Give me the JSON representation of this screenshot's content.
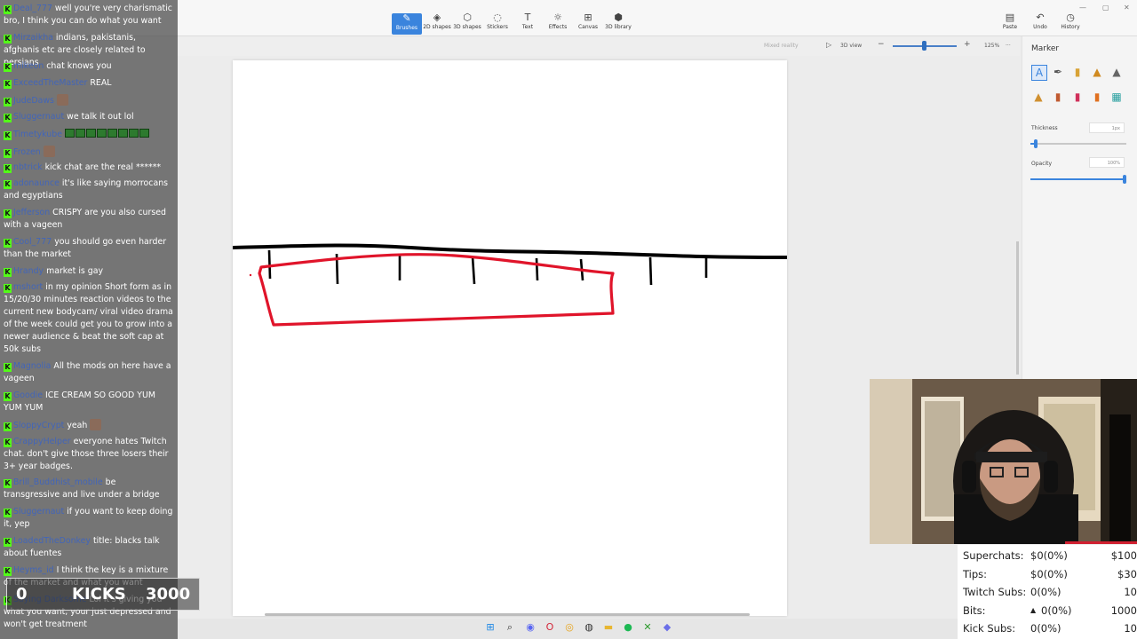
{
  "ribbon": {
    "tools": [
      {
        "label": "Brushes",
        "icon": "brush-icon",
        "glyph": "✎"
      },
      {
        "label": "2D shapes",
        "icon": "shapes-2d-icon",
        "glyph": "◈"
      },
      {
        "label": "3D shapes",
        "icon": "shapes-3d-icon",
        "glyph": "⬡"
      },
      {
        "label": "Stickers",
        "icon": "sticker-icon",
        "glyph": "◌"
      },
      {
        "label": "Text",
        "icon": "text-icon",
        "glyph": "T"
      },
      {
        "label": "Effects",
        "icon": "effects-icon",
        "glyph": "☼"
      },
      {
        "label": "Canvas",
        "icon": "canvas-icon",
        "glyph": "⊞"
      },
      {
        "label": "3D library",
        "icon": "library-3d-icon",
        "glyph": "⬢"
      }
    ],
    "right": [
      {
        "label": "Paste",
        "icon": "paste-icon",
        "glyph": "▤"
      },
      {
        "label": "Undo",
        "icon": "undo-icon",
        "glyph": "↶"
      },
      {
        "label": "History",
        "icon": "history-icon",
        "glyph": "◷"
      }
    ]
  },
  "subbar": {
    "mixed_reality": "Mixed reality",
    "view_3d": "3D view",
    "zoom": "125%",
    "more": "···"
  },
  "panel": {
    "title": "Marker",
    "thickness_label": "Thickness",
    "thickness_value": "1px",
    "thickness_level": 0.04,
    "opacity_label": "Opacity",
    "opacity_value": "100%",
    "opacity_level": 1.0,
    "brushes": [
      {
        "icon": "marker-icon",
        "glyph": "A",
        "color": "#3a84dd"
      },
      {
        "icon": "calligraphy-pen-icon",
        "glyph": "✒",
        "color": "#555"
      },
      {
        "icon": "oil-brush-icon",
        "glyph": "▮",
        "color": "#d8a235"
      },
      {
        "icon": "watercolor-icon",
        "glyph": "▲",
        "color": "#d08a20"
      },
      {
        "icon": "pencil-icon",
        "glyph": "▲",
        "color": "#666"
      },
      {
        "icon": "eraser-icon",
        "glyph": "▲",
        "color": "#d09030"
      },
      {
        "icon": "crayon-icon",
        "glyph": "▮",
        "color": "#c05a30"
      },
      {
        "icon": "pixel-pen-icon",
        "glyph": "▮",
        "color": "#d0305a"
      },
      {
        "icon": "spray-can-icon",
        "glyph": "▮",
        "color": "#e07020"
      },
      {
        "icon": "fill-icon",
        "glyph": "▦",
        "color": "#2aa0a0"
      }
    ]
  },
  "chat": {
    "messages": [
      {
        "user": "Deal_777",
        "text": "well you're very charismatic bro, I think you can do what you want"
      },
      {
        "user": "Mirzaikha",
        "text": "indians, pakistanis, afghanis etc are closely related to persians"
      },
      {
        "user": "mikeon",
        "text": "chat knows you"
      },
      {
        "user": "ExceedTheMaster",
        "text": "REAL"
      },
      {
        "user": "JudeDaws",
        "text": "",
        "emote": true
      },
      {
        "user": "Sluggernaut",
        "text": "we talk it out lol"
      },
      {
        "user": "Timetykube",
        "text": "",
        "emote_row": 8
      },
      {
        "user": "Frozen",
        "text": "",
        "emote": true
      },
      {
        "user": "nbtrick",
        "text": "kick chat are the real ******"
      },
      {
        "user": "adonaunce",
        "text": "it's like saying morrocans and egyptians"
      },
      {
        "user": "Jefferson",
        "text": "CRISPY are you also cursed with a vageen"
      },
      {
        "user": "Cool_777",
        "text": "you should go even harder than the market"
      },
      {
        "user": "Hrandy",
        "text": "market is gay"
      },
      {
        "user": "mshort",
        "text": "in my opinion Short form as in 15/20/30 minutes reaction videos to the current new bodycam/ viral video drama of the week could get you to grow into a newer audience & beat the soft cap at 50k subs"
      },
      {
        "user": "Magnolia",
        "text": "All the mods on here have a vageen"
      },
      {
        "user": "Goodie",
        "text": "ICE CREAM SO GOOD YUM YUM YUM"
      },
      {
        "user": "SloppyCrypt",
        "text": "yeah",
        "emote": true
      },
      {
        "user": "CrappyHelper",
        "text": "everyone hates Twitch chat. don't give those three losers their 3+ year badges."
      },
      {
        "user": "Brill_Buddhist_mobile",
        "text": "be transgressive and live under a bridge"
      },
      {
        "user": "Sluggernaut",
        "text": "if you want to keep doing it, yep"
      },
      {
        "user": "LoadedTheDonkey",
        "text": "title: blacks talk about fuentes"
      },
      {
        "user": "Heyms_id",
        "text": "I think the key is a mixture of the market and what you want"
      },
      {
        "user": "Saying Darksome",
        "text": "Lol it's giving you what you want, your just depressed and won't get treatment"
      }
    ]
  },
  "kicks": {
    "count": "0",
    "label": "KICKS",
    "goal": "3000"
  },
  "stats": {
    "rows": [
      {
        "label": "Superchats:",
        "value": "$0(0%)",
        "goal": "$100"
      },
      {
        "label": "Tips:",
        "value": "$0(0%)",
        "goal": "$30"
      },
      {
        "label": "Twitch Subs:",
        "value": "0(0%)",
        "goal": "10"
      },
      {
        "label": "Bits:",
        "value": "0(0%)",
        "goal": "1000"
      },
      {
        "label": "Kick Subs:",
        "value": "0(0%)",
        "goal": "10"
      }
    ]
  },
  "taskbar": {
    "icons": [
      {
        "name": "windows-start-icon",
        "glyph": "⊞",
        "color": "#1e88e5"
      },
      {
        "name": "search-icon",
        "glyph": "⌕",
        "color": "#333"
      },
      {
        "name": "discord-icon",
        "glyph": "◉",
        "color": "#5865f2"
      },
      {
        "name": "opera-icon",
        "glyph": "O",
        "color": "#d3283b"
      },
      {
        "name": "chrome-icon",
        "glyph": "◎",
        "color": "#e8a41a"
      },
      {
        "name": "obs-icon",
        "glyph": "◍",
        "color": "#333"
      },
      {
        "name": "file-explorer-icon",
        "glyph": "▬",
        "color": "#e8b630"
      },
      {
        "name": "spotify-icon",
        "glyph": "●",
        "color": "#1db954"
      },
      {
        "name": "xbox-icon",
        "glyph": "✕",
        "color": "#2c9a2c"
      },
      {
        "name": "paint-3d-icon",
        "glyph": "◆",
        "color": "#6a6ee8"
      }
    ]
  },
  "colors": {
    "marker_red": "#e0142a",
    "marker_black": "#000000",
    "accent": "#3a84dd"
  }
}
